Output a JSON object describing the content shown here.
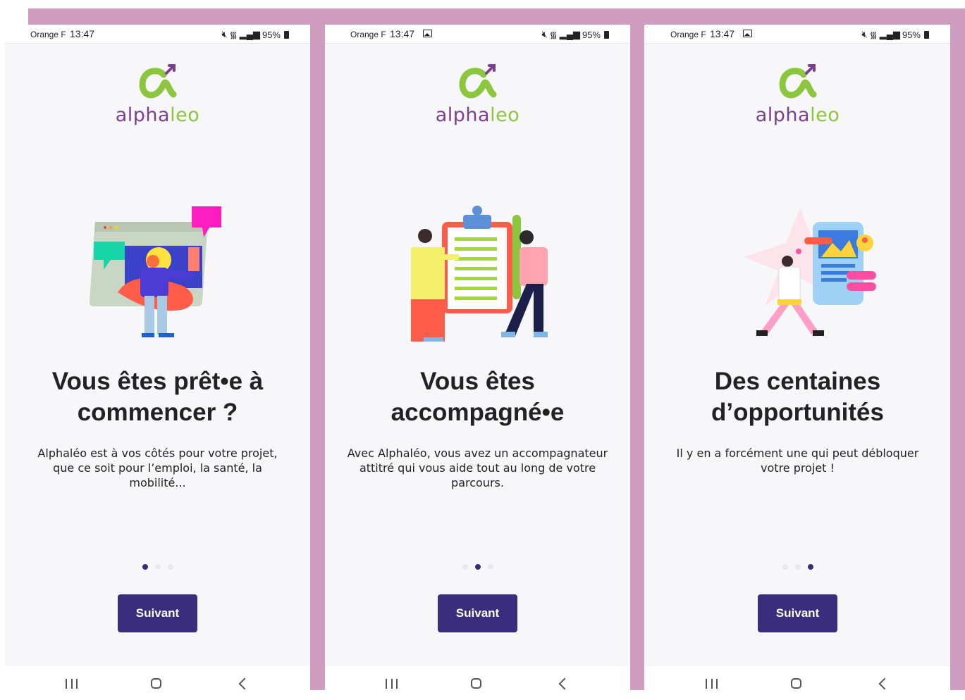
{
  "colors": {
    "background_band": "#cf9dbf",
    "screen_bg": "#f7f7f9",
    "primary": "#3a2d7d",
    "logo_purple": "#7c3f8f",
    "logo_green": "#8cc63f",
    "dot_inactive": "#e8e8ee"
  },
  "screens": [
    {
      "status": {
        "carrier": "Orange F",
        "time": "13:47",
        "battery": "95%",
        "show_gallery_icon": false
      },
      "logo": {
        "part1": "alpha",
        "part2": "leo"
      },
      "illustration": "person-presenting-screen-illustration",
      "title": "Vous êtes prêt•e à commencer ?",
      "description": "Alphaléo est à vos côtés pour votre projet, que ce soit pour l’emploi, la santé, la mobilité...",
      "page_dots": {
        "count": 3,
        "active_index": 0
      },
      "button_label": "Suivant"
    },
    {
      "status": {
        "carrier": "Orange F",
        "time": "13:47",
        "battery": "95%",
        "show_gallery_icon": true
      },
      "logo": {
        "part1": "alpha",
        "part2": "leo"
      },
      "illustration": "two-people-clipboard-illustration",
      "title": "Vous êtes accompagné•e",
      "description": "Avec Alphaléo, vous avez un accompagnateur attitré qui vous aide tout au long de votre parcours.",
      "page_dots": {
        "count": 3,
        "active_index": 1
      },
      "button_label": "Suivant"
    },
    {
      "status": {
        "carrier": "Orange F",
        "time": "13:47",
        "battery": "95%",
        "show_gallery_icon": true
      },
      "logo": {
        "part1": "alpha",
        "part2": "leo"
      },
      "illustration": "person-walking-to-phone-illustration",
      "title": "Des centaines d’opportunités",
      "description": "Il y en a forcément une qui peut débloquer votre projet !",
      "page_dots": {
        "count": 3,
        "active_index": 2
      },
      "button_label": "Suivant"
    }
  ]
}
